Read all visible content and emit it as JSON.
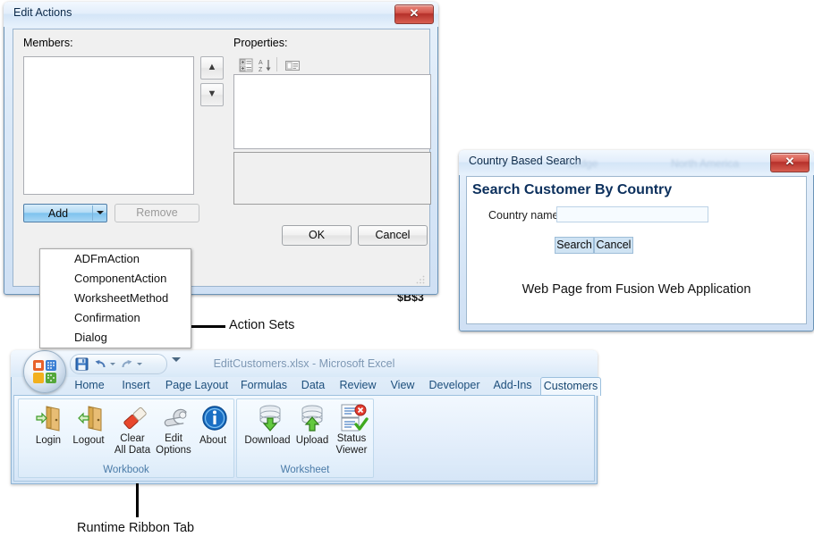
{
  "edit_actions_dialog": {
    "title": "Edit Actions",
    "close_label": "Close",
    "members_label": "Members:",
    "properties_label": "Properties:",
    "move_up_icon": "arrow-up-icon",
    "move_down_icon": "arrow-down-icon",
    "prop_toolbar": {
      "categorized_icon": "categorized-view-icon",
      "alphabetical_icon": "sort-alphabetical-icon",
      "property_pages_icon": "property-pages-icon"
    },
    "add_button": "Add",
    "remove_button": "Remove",
    "ok_button": "OK",
    "cancel_button": "Cancel",
    "add_menu_items": [
      "ADFmAction",
      "ComponentAction",
      "WorksheetMethod",
      "Confirmation",
      "Dialog"
    ]
  },
  "country_window": {
    "title": "Country Based Search",
    "ghost_text_left": "Lodge",
    "ghost_text_right": "North America",
    "close_label": "Close",
    "heading": "Search Customer By Country",
    "field_label": "Country name",
    "field_value": "",
    "field_placeholder": "",
    "search_button": "Search",
    "cancel_button": "Cancel",
    "note": "Web Page from Fusion Web Application"
  },
  "excel_window": {
    "title": "EditCustomers.xlsx - Microsoft Excel",
    "orb_icon": "office-orb-icon",
    "quick_access": [
      {
        "name": "save-icon",
        "label": "Save"
      },
      {
        "name": "undo-icon",
        "label": "Undo"
      },
      {
        "name": "redo-icon",
        "label": "Redo"
      }
    ],
    "qat_customize_icon": "customize-qat-icon",
    "tabs": [
      "Home",
      "Insert",
      "Page Layout",
      "Formulas",
      "Data",
      "Review",
      "View",
      "Developer",
      "Add-Ins",
      "Customers"
    ],
    "active_tab": "Customers",
    "groups": [
      {
        "title": "Workbook",
        "buttons": [
          {
            "label": "Login",
            "label2": "",
            "icon": "door-enter-icon"
          },
          {
            "label": "Logout",
            "label2": "",
            "icon": "door-exit-icon"
          },
          {
            "label": "Clear",
            "label2": "All Data",
            "icon": "eraser-icon"
          },
          {
            "label": "Edit",
            "label2": "Options",
            "icon": "wrench-icon"
          },
          {
            "label": "About",
            "label2": "",
            "icon": "info-icon"
          }
        ]
      },
      {
        "title": "Worksheet",
        "buttons": [
          {
            "label": "Download",
            "label2": "",
            "icon": "database-download-icon"
          },
          {
            "label": "Upload",
            "label2": "",
            "icon": "database-upload-icon"
          },
          {
            "label": "Status",
            "label2": "Viewer",
            "icon": "status-viewer-icon"
          }
        ]
      }
    ]
  },
  "background": {
    "cell_reference": "$B$3"
  },
  "callouts": {
    "action_sets": "Action Sets",
    "runtime_ribbon_tab": "Runtime Ribbon Tab"
  },
  "colors": {
    "aero_border": "#6a93b7",
    "close_red": "#b5302a",
    "excel_tab_text": "#1d4f7c",
    "heading_blue": "#0b2f5c",
    "accent_green": "#4aa432"
  }
}
